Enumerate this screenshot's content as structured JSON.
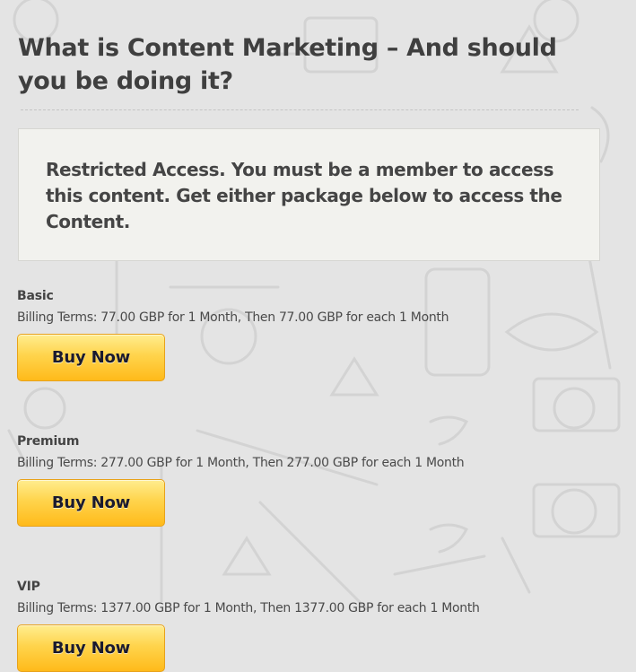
{
  "page": {
    "title": "What is Content Marketing – And should you be doing it?"
  },
  "notice": {
    "text": "Restricted Access. You must be a member to access this content. Get either package below to access the Content."
  },
  "packages": [
    {
      "name": "Basic",
      "terms": "Billing Terms: 77.00 GBP for 1 Month, Then 77.00 GBP for each 1 Month",
      "button_label": "Buy Now"
    },
    {
      "name": "Premium",
      "terms": "Billing Terms: 277.00 GBP for 1 Month, Then 277.00 GBP for each 1 Month",
      "button_label": "Buy Now"
    },
    {
      "name": "VIP",
      "terms": "Billing Terms: 1377.00 GBP for 1 Month, Then 1377.00 GBP for each 1 Month",
      "button_label": "Buy Now"
    }
  ],
  "colors": {
    "background": "#e4e4e4",
    "notice_background": "#f2f2ee",
    "button_top": "#ffed8f",
    "button_bottom": "#ffba1a",
    "text": "#444444"
  }
}
